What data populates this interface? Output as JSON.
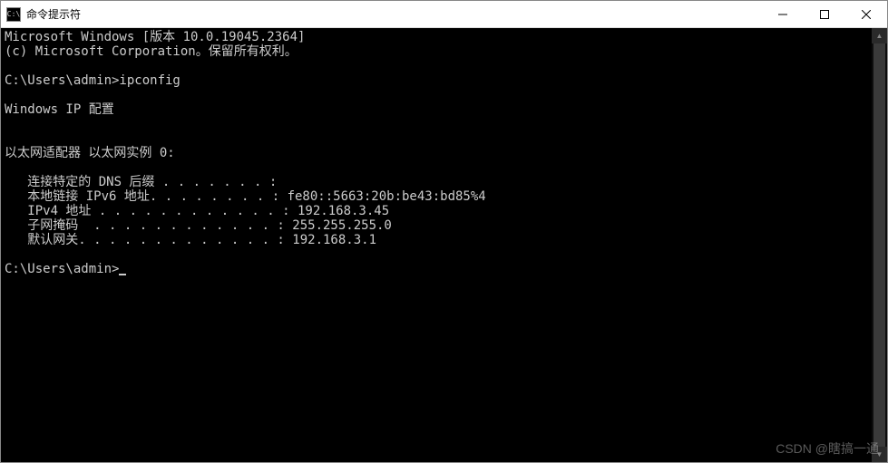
{
  "window": {
    "title": "命令提示符",
    "icon_label": "C:\\"
  },
  "terminal": {
    "lines": {
      "version": "Microsoft Windows [版本 10.0.19045.2364]",
      "copyright": "(c) Microsoft Corporation。保留所有权利。",
      "blank1": "",
      "prompt_cmd": "C:\\Users\\admin>ipconfig",
      "blank2": "",
      "ip_config_header": "Windows IP 配置",
      "blank3": "",
      "blank4": "",
      "adapter_header": "以太网适配器 以太网实例 0:",
      "blank5": "",
      "dns_suffix": "   连接特定的 DNS 后缀 . . . . . . . :",
      "ipv6_line": "   本地链接 IPv6 地址. . . . . . . . : fe80::5663:20b:be43:bd85%4",
      "ipv4_line": "   IPv4 地址 . . . . . . . . . . . . : 192.168.3.45",
      "subnet_line": "   子网掩码  . . . . . . . . . . . . : 255.255.255.0",
      "gateway_line": "   默认网关. . . . . . . . . . . . . : 192.168.3.1",
      "blank6": "",
      "prompt_idle": "C:\\Users\\admin>"
    }
  },
  "watermark": "CSDN @瞎搞一通"
}
